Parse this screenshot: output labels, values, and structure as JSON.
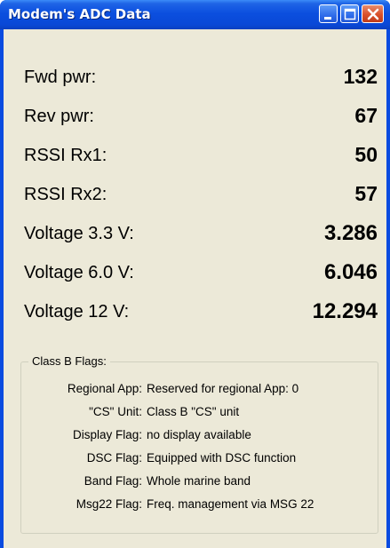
{
  "window": {
    "title": "Modem's ADC Data"
  },
  "readings": [
    {
      "label": "Fwd pwr:",
      "value": "132"
    },
    {
      "label": "Rev pwr:",
      "value": "67"
    },
    {
      "label": "RSSI Rx1:",
      "value": "50"
    },
    {
      "label": "RSSI Rx2:",
      "value": "57"
    },
    {
      "label": "Voltage 3.3 V:",
      "value": "3.286"
    },
    {
      "label": "Voltage 6.0 V:",
      "value": "6.046"
    },
    {
      "label": "Voltage 12 V:",
      "value": "12.294"
    }
  ],
  "flags": {
    "legend": "Class B Flags:",
    "items": [
      {
        "label": "Regional App:",
        "value": "Reserved for regional App: 0"
      },
      {
        "label": "\"CS\" Unit:",
        "value": "Class B \"CS\" unit"
      },
      {
        "label": "Display Flag:",
        "value": "no display available"
      },
      {
        "label": "DSC Flag:",
        "value": "Equipped with DSC function"
      },
      {
        "label": "Band Flag:",
        "value": "Whole marine band"
      },
      {
        "label": "Msg22 Flag:",
        "value": "Freq. management via MSG 22"
      }
    ]
  },
  "colors": {
    "titlebar": "#0a4be0",
    "client_background": "#ece9d8",
    "close_button": "#d9502a"
  },
  "icons": [
    "minimize-icon",
    "maximize-icon",
    "close-icon"
  ]
}
